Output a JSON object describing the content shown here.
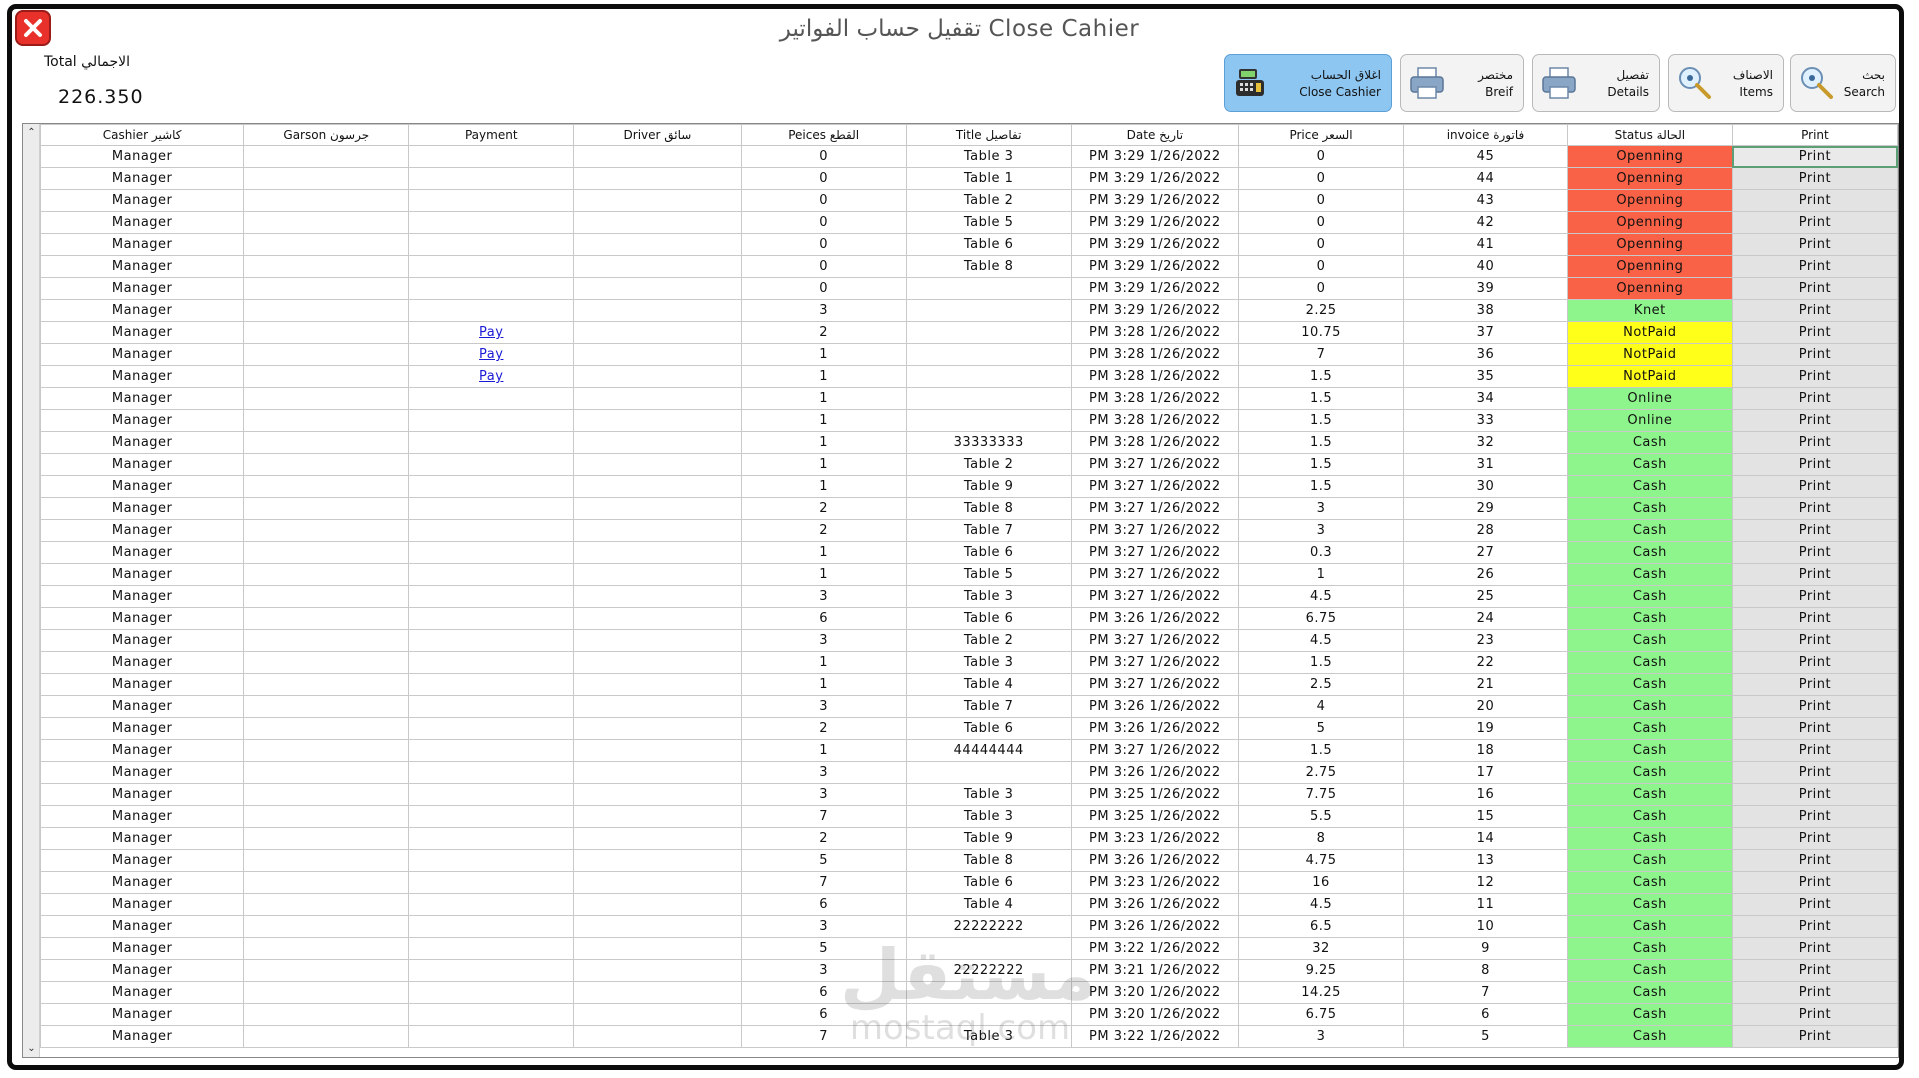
{
  "window": {
    "title": "تقفيل حساب الفواتير Close Cahier",
    "close_icon": "close-x-icon",
    "frame_color": "#0c0c0c"
  },
  "total": {
    "label": "Total الاجمالي",
    "value": "226.350"
  },
  "toolbar": [
    {
      "key": "close-cashier",
      "label_ar": "اغلاق الحساب",
      "label_en": "Close Cashier",
      "icon": "cash-register-icon",
      "active": true
    },
    {
      "key": "brief",
      "label_ar": "مختصر",
      "label_en": "Breif",
      "icon": "printer-icon",
      "active": false
    },
    {
      "key": "details",
      "label_ar": "تفصيل",
      "label_en": "Details",
      "icon": "printer-icon",
      "active": false
    },
    {
      "key": "items",
      "label_ar": "الاصناف",
      "label_en": "Items",
      "icon": "magnifier-icon",
      "active": false
    },
    {
      "key": "search",
      "label_ar": "بحث",
      "label_en": "Search",
      "icon": "magnifier-icon",
      "active": false
    }
  ],
  "table": {
    "columns": [
      "Cashier كاشير",
      "Garson جرسون",
      "Payment",
      "Driver سائق",
      "Peices القطع",
      "Title تفاصيل",
      "Date تاريخ",
      "Price السعر",
      "invoice فاتورة",
      "Status الحالة",
      "Print"
    ],
    "print_label": "Print",
    "pay_label": "Pay",
    "status_colors": {
      "Openning": "#fa6247",
      "NotPaid": "#ffff1a",
      "Knet": "#8ef58c",
      "Online": "#8ef58c",
      "Cash": "#8ef58c"
    },
    "rows": [
      {
        "cashier": "Manager",
        "garson": "",
        "payment": "",
        "driver": "",
        "pieces": "0",
        "title": "Table 3",
        "date": "PM 3:29 1/26/2022",
        "price": "0",
        "invoice": "45",
        "status": "Openning"
      },
      {
        "cashier": "Manager",
        "garson": "",
        "payment": "",
        "driver": "",
        "pieces": "0",
        "title": "Table 1",
        "date": "PM 3:29 1/26/2022",
        "price": "0",
        "invoice": "44",
        "status": "Openning"
      },
      {
        "cashier": "Manager",
        "garson": "",
        "payment": "",
        "driver": "",
        "pieces": "0",
        "title": "Table 2",
        "date": "PM 3:29 1/26/2022",
        "price": "0",
        "invoice": "43",
        "status": "Openning"
      },
      {
        "cashier": "Manager",
        "garson": "",
        "payment": "",
        "driver": "",
        "pieces": "0",
        "title": "Table 5",
        "date": "PM 3:29 1/26/2022",
        "price": "0",
        "invoice": "42",
        "status": "Openning"
      },
      {
        "cashier": "Manager",
        "garson": "",
        "payment": "",
        "driver": "",
        "pieces": "0",
        "title": "Table 6",
        "date": "PM 3:29 1/26/2022",
        "price": "0",
        "invoice": "41",
        "status": "Openning"
      },
      {
        "cashier": "Manager",
        "garson": "",
        "payment": "",
        "driver": "",
        "pieces": "0",
        "title": "Table 8",
        "date": "PM 3:29 1/26/2022",
        "price": "0",
        "invoice": "40",
        "status": "Openning"
      },
      {
        "cashier": "Manager",
        "garson": "",
        "payment": "",
        "driver": "",
        "pieces": "0",
        "title": "",
        "date": "PM 3:29 1/26/2022",
        "price": "0",
        "invoice": "39",
        "status": "Openning"
      },
      {
        "cashier": "Manager",
        "garson": "",
        "payment": "",
        "driver": "",
        "pieces": "3",
        "title": "",
        "date": "PM 3:29 1/26/2022",
        "price": "2.25",
        "invoice": "38",
        "status": "Knet"
      },
      {
        "cashier": "Manager",
        "garson": "",
        "payment": "Pay",
        "driver": "",
        "pieces": "2",
        "title": "",
        "date": "PM 3:28 1/26/2022",
        "price": "10.75",
        "invoice": "37",
        "status": "NotPaid"
      },
      {
        "cashier": "Manager",
        "garson": "",
        "payment": "Pay",
        "driver": "",
        "pieces": "1",
        "title": "",
        "date": "PM 3:28 1/26/2022",
        "price": "7",
        "invoice": "36",
        "status": "NotPaid"
      },
      {
        "cashier": "Manager",
        "garson": "",
        "payment": "Pay",
        "driver": "",
        "pieces": "1",
        "title": "",
        "date": "PM 3:28 1/26/2022",
        "price": "1.5",
        "invoice": "35",
        "status": "NotPaid"
      },
      {
        "cashier": "Manager",
        "garson": "",
        "payment": "",
        "driver": "",
        "pieces": "1",
        "title": "",
        "date": "PM 3:28 1/26/2022",
        "price": "1.5",
        "invoice": "34",
        "status": "Online"
      },
      {
        "cashier": "Manager",
        "garson": "",
        "payment": "",
        "driver": "",
        "pieces": "1",
        "title": "",
        "date": "PM 3:28 1/26/2022",
        "price": "1.5",
        "invoice": "33",
        "status": "Online"
      },
      {
        "cashier": "Manager",
        "garson": "",
        "payment": "",
        "driver": "",
        "pieces": "1",
        "title": "33333333",
        "date": "PM 3:28 1/26/2022",
        "price": "1.5",
        "invoice": "32",
        "status": "Cash"
      },
      {
        "cashier": "Manager",
        "garson": "",
        "payment": "",
        "driver": "",
        "pieces": "1",
        "title": "Table 2",
        "date": "PM 3:27 1/26/2022",
        "price": "1.5",
        "invoice": "31",
        "status": "Cash"
      },
      {
        "cashier": "Manager",
        "garson": "",
        "payment": "",
        "driver": "",
        "pieces": "1",
        "title": "Table 9",
        "date": "PM 3:27 1/26/2022",
        "price": "1.5",
        "invoice": "30",
        "status": "Cash"
      },
      {
        "cashier": "Manager",
        "garson": "",
        "payment": "",
        "driver": "",
        "pieces": "2",
        "title": "Table 8",
        "date": "PM 3:27 1/26/2022",
        "price": "3",
        "invoice": "29",
        "status": "Cash"
      },
      {
        "cashier": "Manager",
        "garson": "",
        "payment": "",
        "driver": "",
        "pieces": "2",
        "title": "Table 7",
        "date": "PM 3:27 1/26/2022",
        "price": "3",
        "invoice": "28",
        "status": "Cash"
      },
      {
        "cashier": "Manager",
        "garson": "",
        "payment": "",
        "driver": "",
        "pieces": "1",
        "title": "Table 6",
        "date": "PM 3:27 1/26/2022",
        "price": "0.3",
        "invoice": "27",
        "status": "Cash"
      },
      {
        "cashier": "Manager",
        "garson": "",
        "payment": "",
        "driver": "",
        "pieces": "1",
        "title": "Table 5",
        "date": "PM 3:27 1/26/2022",
        "price": "1",
        "invoice": "26",
        "status": "Cash"
      },
      {
        "cashier": "Manager",
        "garson": "",
        "payment": "",
        "driver": "",
        "pieces": "3",
        "title": "Table 3",
        "date": "PM 3:27 1/26/2022",
        "price": "4.5",
        "invoice": "25",
        "status": "Cash"
      },
      {
        "cashier": "Manager",
        "garson": "",
        "payment": "",
        "driver": "",
        "pieces": "6",
        "title": "Table 6",
        "date": "PM 3:26 1/26/2022",
        "price": "6.75",
        "invoice": "24",
        "status": "Cash"
      },
      {
        "cashier": "Manager",
        "garson": "",
        "payment": "",
        "driver": "",
        "pieces": "3",
        "title": "Table 2",
        "date": "PM 3:27 1/26/2022",
        "price": "4.5",
        "invoice": "23",
        "status": "Cash"
      },
      {
        "cashier": "Manager",
        "garson": "",
        "payment": "",
        "driver": "",
        "pieces": "1",
        "title": "Table 3",
        "date": "PM 3:27 1/26/2022",
        "price": "1.5",
        "invoice": "22",
        "status": "Cash"
      },
      {
        "cashier": "Manager",
        "garson": "",
        "payment": "",
        "driver": "",
        "pieces": "1",
        "title": "Table 4",
        "date": "PM 3:27 1/26/2022",
        "price": "2.5",
        "invoice": "21",
        "status": "Cash"
      },
      {
        "cashier": "Manager",
        "garson": "",
        "payment": "",
        "driver": "",
        "pieces": "3",
        "title": "Table 7",
        "date": "PM 3:26 1/26/2022",
        "price": "4",
        "invoice": "20",
        "status": "Cash"
      },
      {
        "cashier": "Manager",
        "garson": "",
        "payment": "",
        "driver": "",
        "pieces": "2",
        "title": "Table 6",
        "date": "PM 3:26 1/26/2022",
        "price": "5",
        "invoice": "19",
        "status": "Cash"
      },
      {
        "cashier": "Manager",
        "garson": "",
        "payment": "",
        "driver": "",
        "pieces": "1",
        "title": "44444444",
        "date": "PM 3:27 1/26/2022",
        "price": "1.5",
        "invoice": "18",
        "status": "Cash"
      },
      {
        "cashier": "Manager",
        "garson": "",
        "payment": "",
        "driver": "",
        "pieces": "3",
        "title": "",
        "date": "PM 3:26 1/26/2022",
        "price": "2.75",
        "invoice": "17",
        "status": "Cash"
      },
      {
        "cashier": "Manager",
        "garson": "",
        "payment": "",
        "driver": "",
        "pieces": "3",
        "title": "Table 3",
        "date": "PM 3:25 1/26/2022",
        "price": "7.75",
        "invoice": "16",
        "status": "Cash"
      },
      {
        "cashier": "Manager",
        "garson": "",
        "payment": "",
        "driver": "",
        "pieces": "7",
        "title": "Table 3",
        "date": "PM 3:25 1/26/2022",
        "price": "5.5",
        "invoice": "15",
        "status": "Cash"
      },
      {
        "cashier": "Manager",
        "garson": "",
        "payment": "",
        "driver": "",
        "pieces": "2",
        "title": "Table 9",
        "date": "PM 3:23 1/26/2022",
        "price": "8",
        "invoice": "14",
        "status": "Cash"
      },
      {
        "cashier": "Manager",
        "garson": "",
        "payment": "",
        "driver": "",
        "pieces": "5",
        "title": "Table 8",
        "date": "PM 3:26 1/26/2022",
        "price": "4.75",
        "invoice": "13",
        "status": "Cash"
      },
      {
        "cashier": "Manager",
        "garson": "",
        "payment": "",
        "driver": "",
        "pieces": "7",
        "title": "Table 6",
        "date": "PM 3:23 1/26/2022",
        "price": "16",
        "invoice": "12",
        "status": "Cash"
      },
      {
        "cashier": "Manager",
        "garson": "",
        "payment": "",
        "driver": "",
        "pieces": "6",
        "title": "Table 4",
        "date": "PM 3:26 1/26/2022",
        "price": "4.5",
        "invoice": "11",
        "status": "Cash"
      },
      {
        "cashier": "Manager",
        "garson": "",
        "payment": "",
        "driver": "",
        "pieces": "3",
        "title": "22222222",
        "date": "PM 3:26 1/26/2022",
        "price": "6.5",
        "invoice": "10",
        "status": "Cash"
      },
      {
        "cashier": "Manager",
        "garson": "",
        "payment": "",
        "driver": "",
        "pieces": "5",
        "title": "",
        "date": "PM 3:22 1/26/2022",
        "price": "32",
        "invoice": "9",
        "status": "Cash"
      },
      {
        "cashier": "Manager",
        "garson": "",
        "payment": "",
        "driver": "",
        "pieces": "3",
        "title": "22222222",
        "date": "PM 3:21 1/26/2022",
        "price": "9.25",
        "invoice": "8",
        "status": "Cash"
      },
      {
        "cashier": "Manager",
        "garson": "",
        "payment": "",
        "driver": "",
        "pieces": "6",
        "title": "",
        "date": "PM 3:20 1/26/2022",
        "price": "14.25",
        "invoice": "7",
        "status": "Cash"
      },
      {
        "cashier": "Manager",
        "garson": "",
        "payment": "",
        "driver": "",
        "pieces": "6",
        "title": "",
        "date": "PM 3:20 1/26/2022",
        "price": "6.75",
        "invoice": "6",
        "status": "Cash"
      },
      {
        "cashier": "Manager",
        "garson": "",
        "payment": "",
        "driver": "",
        "pieces": "7",
        "title": "Table 3",
        "date": "PM 3:22 1/26/2022",
        "price": "3",
        "invoice": "5",
        "status": "Cash"
      }
    ]
  },
  "watermark": {
    "arabic": "مستقل",
    "english": "mostaql.com"
  }
}
